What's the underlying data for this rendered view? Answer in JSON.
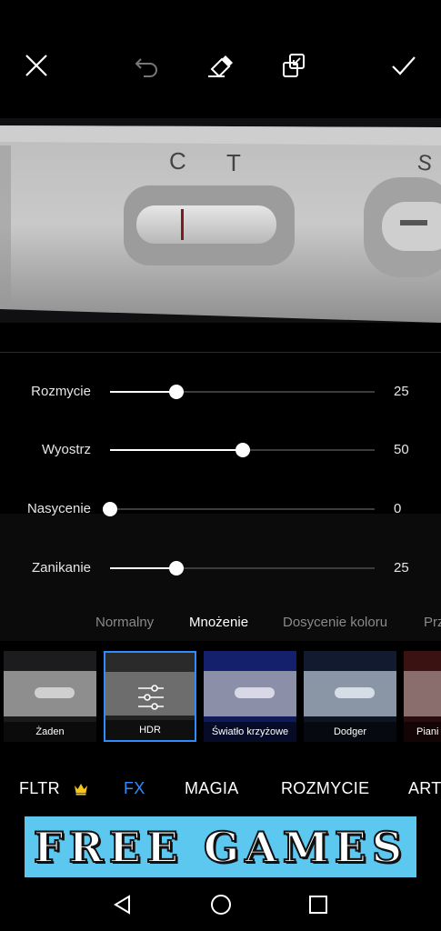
{
  "toolbar": {
    "close_icon": "close-icon",
    "undo_icon": "undo-icon",
    "eraser_icon": "eraser-icon",
    "compare_icon": "compare-icon",
    "apply_icon": "check-icon"
  },
  "photo": {
    "marks": [
      "C",
      "T",
      "S"
    ]
  },
  "sliders": [
    {
      "label": "Rozmycie",
      "value": "25",
      "fraction": 0.25
    },
    {
      "label": "Wyostrz",
      "value": "50",
      "fraction": 0.5
    },
    {
      "label": "Nasycenie",
      "value": "0",
      "fraction": 0.0
    },
    {
      "label": "Zanikanie",
      "value": "25",
      "fraction": 0.25
    }
  ],
  "blend_modes": [
    {
      "label": "Normalny"
    },
    {
      "label": "Mnożenie",
      "selected": true
    },
    {
      "label": "Dosycenie koloru"
    },
    {
      "label": "Prz"
    }
  ],
  "filters": [
    {
      "label": "Żaden"
    },
    {
      "label": "HDR",
      "selected": true
    },
    {
      "label": "Światło krzyżowe"
    },
    {
      "label": "Dodger"
    },
    {
      "label": "Piani"
    }
  ],
  "categories": [
    {
      "label": "FLTR",
      "premium_icon": "crown-icon"
    },
    {
      "label": "FX",
      "active": true
    },
    {
      "label": "MAGIA"
    },
    {
      "label": "ROZMYCIE"
    },
    {
      "label": "ART"
    }
  ],
  "ad": {
    "text": "FREE GAMES"
  },
  "nav": {
    "back_icon": "back-triangle-icon",
    "home_icon": "home-circle-icon",
    "recents_icon": "recents-square-icon"
  },
  "colors": {
    "accent": "#2f8cff",
    "ad_background": "#5cc7ef",
    "premium": "#f5c518"
  }
}
